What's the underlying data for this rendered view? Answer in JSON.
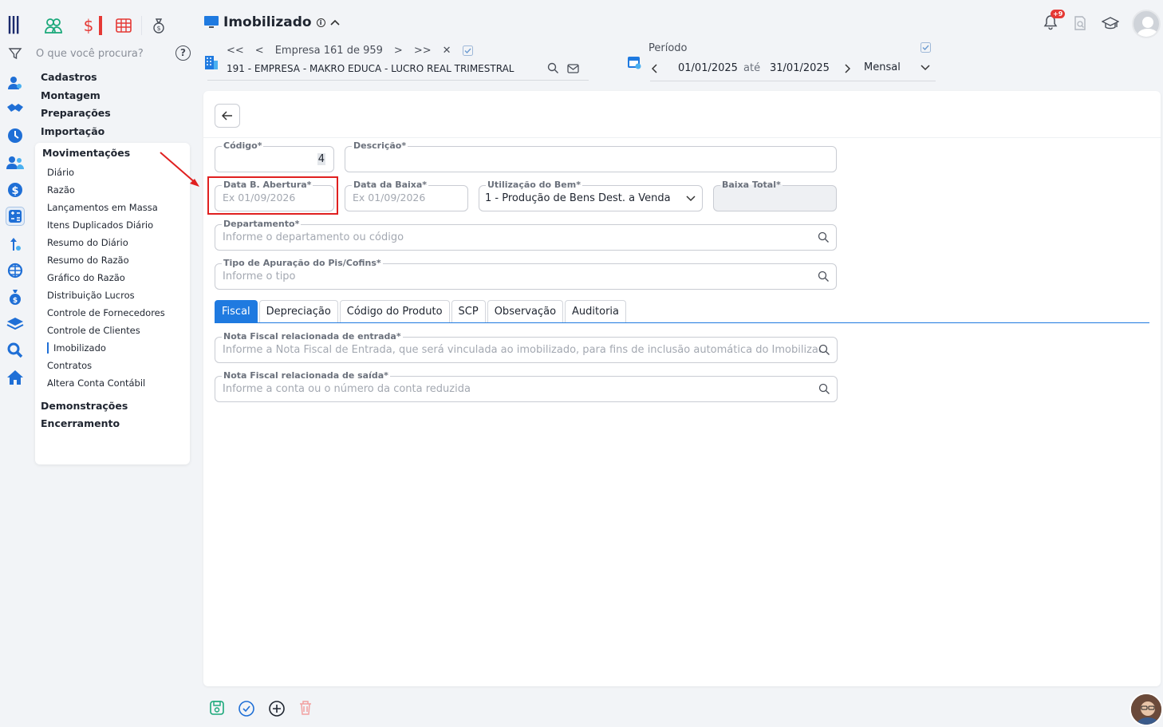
{
  "app": {
    "title": "Imobilizado"
  },
  "search": {
    "placeholder": "O que você procura?",
    "help": "?"
  },
  "menu": {
    "headers": [
      "Cadastros",
      "Montagem",
      "Preparações",
      "Importação"
    ],
    "open_section": "Movimentações",
    "items": [
      "Diário",
      "Razão",
      "Lançamentos em Massa",
      "Itens Duplicados Diário",
      "Resumo do Diário",
      "Resumo do Razão",
      "Gráfico do Razão",
      "Distribuição Lucros",
      "Controle de Fornecedores",
      "Controle de Clientes",
      "Imobilizado",
      "Contratos",
      "Altera Conta Contábil"
    ],
    "current_item": "Imobilizado",
    "footer": [
      "Demonstrações",
      "Encerramento"
    ]
  },
  "empresa": {
    "first": "<<",
    "prev": "<",
    "counter": "Empresa 161 de 959",
    "next": ">",
    "last": ">>",
    "close": "✕",
    "name": "191 - EMPRESA - MAKRO EDUCA - LUCRO REAL TRIMESTRAL"
  },
  "periodo": {
    "label": "Período",
    "start": "01/01/2025",
    "sep": "até",
    "end": "31/01/2025",
    "mode": "Mensal"
  },
  "notifications": {
    "badge": "+9"
  },
  "form": {
    "codigo": {
      "label": "Código*",
      "value": "4"
    },
    "descricao": {
      "label": "Descrição*",
      "value": ""
    },
    "data_abertura": {
      "label": "Data B. Abertura*",
      "placeholder": "Ex 01/09/2026"
    },
    "data_baixa": {
      "label": "Data da Baixa*",
      "placeholder": "Ex 01/09/2026"
    },
    "utilizacao": {
      "label": "Utilização do Bem*",
      "value": "1 - Produção de Bens Dest. a Venda"
    },
    "baixa_total": {
      "label": "Baixa Total*",
      "value": ""
    },
    "departamento": {
      "label": "Departamento*",
      "placeholder": "Informe o departamento ou código"
    },
    "tipo_apuracao": {
      "label": "Tipo de Apuração do Pis/Cofins*",
      "placeholder": "Informe o tipo"
    }
  },
  "tabs": [
    {
      "label": "Fiscal",
      "active": true
    },
    {
      "label": "Depreciação",
      "active": false
    },
    {
      "label": "Código do Produto",
      "active": false
    },
    {
      "label": "SCP",
      "active": false
    },
    {
      "label": "Observação",
      "active": false
    },
    {
      "label": "Auditoria",
      "active": false
    }
  ],
  "fiscal": {
    "nf_entrada": {
      "label": "Nota Fiscal relacionada de entrada*",
      "placeholder": "Informe a Nota Fiscal de Entrada, que será vinculada ao imobilizado, para fins de inclusão automática do Imobilizado no"
    },
    "nf_saida": {
      "label": "Nota Fiscal relacionada de saída*",
      "placeholder": "Informe a conta ou o número da conta reduzida"
    }
  },
  "colors": {
    "accent": "#1f7ae0",
    "highlight": "#e02020",
    "green": "#1aa87a",
    "red": "#e53935"
  }
}
